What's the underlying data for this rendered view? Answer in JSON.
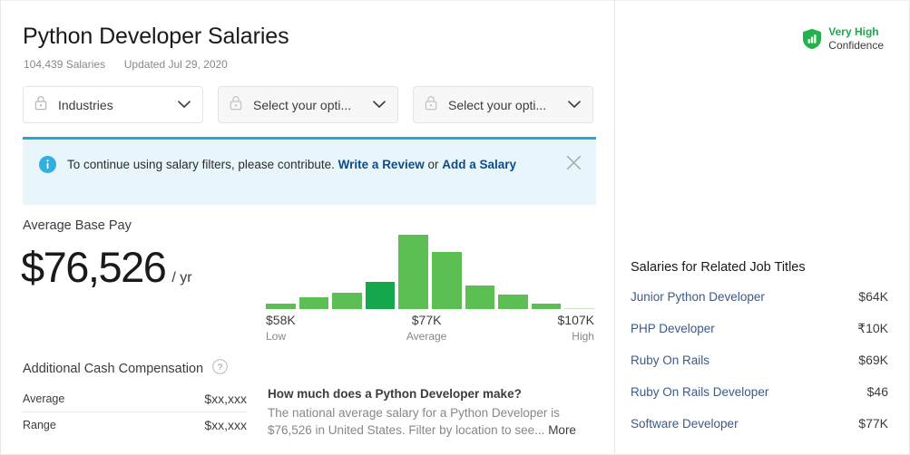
{
  "header": {
    "title": "Python Developer Salaries",
    "salaries_count": "104,439 Salaries",
    "updated": "Updated Jul 29, 2020"
  },
  "confidence": {
    "icon": "shield-bars-icon",
    "level": "Very High",
    "label": "Confidence",
    "color": "#20a84a"
  },
  "filters": [
    {
      "icon": "lock-icon",
      "label": "Industries",
      "chevron": "chevron-down-icon"
    },
    {
      "icon": "lock-icon",
      "label": "Select your opti...",
      "chevron": "chevron-down-icon"
    },
    {
      "icon": "lock-icon",
      "label": "Select your opti...",
      "chevron": "chevron-down-icon"
    }
  ],
  "banner": {
    "icon": "info-icon",
    "text_before": "To continue using salary filters, please contribute. ",
    "link1": "Write a Review",
    "text_middle": " or ",
    "link2": "Add a Salary",
    "close_icon": "close-icon",
    "accent_color": "#25a6d4",
    "background_color": "#e8f6fc"
  },
  "average_base_pay": {
    "label": "Average Base Pay",
    "amount": "$76,526",
    "period": "/ yr"
  },
  "chart_data": {
    "type": "bar",
    "title": "Python Developer base pay distribution",
    "xlabel": "",
    "ylabel": "",
    "grid": false,
    "legend": null,
    "categories": [
      "1",
      "2",
      "3",
      "4",
      "5",
      "6",
      "7",
      "8",
      "9",
      "10"
    ],
    "values": [
      6,
      13,
      18,
      30,
      82,
      63,
      26,
      16,
      6,
      1
    ],
    "ylim": [
      0,
      88
    ],
    "highlight_index": 3,
    "bar_color": "#5cbf54",
    "highlight_color": "#14a74b",
    "axis_labels": [
      {
        "value": "$58K",
        "sub": "Low"
      },
      {
        "value": "$77K",
        "sub": "Average"
      },
      {
        "value": "$107K",
        "sub": "High"
      }
    ]
  },
  "additional_cash": {
    "title": "Additional Cash Compensation",
    "help_icon": "help-circle-icon",
    "rows": [
      {
        "label": "Average",
        "value": "$xx,xxx"
      },
      {
        "label": "Range",
        "value": "$xx,xxx"
      }
    ]
  },
  "blurb": {
    "question": "How much does a Python Developer make?",
    "answer": "The national average salary for a Python Developer is $76,526 in United States. Filter by location to see... ",
    "more": "More"
  },
  "related": {
    "title": "Salaries for Related Job Titles",
    "items": [
      {
        "name": "Junior Python Developer",
        "value": "$64K"
      },
      {
        "name": "PHP Developer",
        "value": "₹10K"
      },
      {
        "name": "Ruby On Rails",
        "value": "$69K"
      },
      {
        "name": "Ruby On Rails Developer",
        "value": "$46"
      },
      {
        "name": "Software Developer",
        "value": "$77K"
      }
    ]
  }
}
